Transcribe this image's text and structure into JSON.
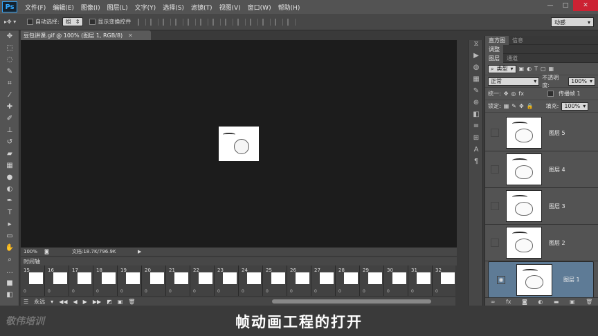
{
  "app": {
    "logo": "Ps"
  },
  "menu": [
    "文件(F)",
    "编辑(E)",
    "图像(I)",
    "图层(L)",
    "文字(Y)",
    "选择(S)",
    "滤镜(T)",
    "视图(V)",
    "窗口(W)",
    "帮助(H)"
  ],
  "options": {
    "auto_select_label": "自动选择:",
    "auto_select_value": "组",
    "show_transform_label": "显示变换控件",
    "workspace": "动感"
  },
  "document": {
    "tab_title": "豆包讲课.gif @ 100% (图层 1, RGB/8)",
    "zoom": "100%",
    "doc_size": "文档:18.7K/796.9K"
  },
  "timeline": {
    "title": "时间轴",
    "frames": [
      "15",
      "16",
      "17",
      "18",
      "19",
      "20",
      "21",
      "22",
      "23",
      "24",
      "25",
      "26",
      "27",
      "28",
      "29",
      "30",
      "31",
      "32"
    ],
    "delay": "0",
    "loop": "永远"
  },
  "panels": {
    "tabs_top": [
      "直方图",
      "信息"
    ],
    "adjust_tab": "调整",
    "layer_tabs": [
      "图层",
      "通道"
    ],
    "kind": "类型",
    "blend": "正常",
    "opacity_label": "不透明度:",
    "opacity": "100%",
    "unify_label": "统一:",
    "propagate_label": "传播帧 1",
    "lock_label": "锁定:",
    "fill_label": "填充:",
    "fill": "100%",
    "layers": [
      "图层 5",
      "图层 4",
      "图层 3",
      "图层 2",
      "图层 1"
    ]
  },
  "caption": "帧动画工程的打开",
  "watermark": "敬伟培训"
}
